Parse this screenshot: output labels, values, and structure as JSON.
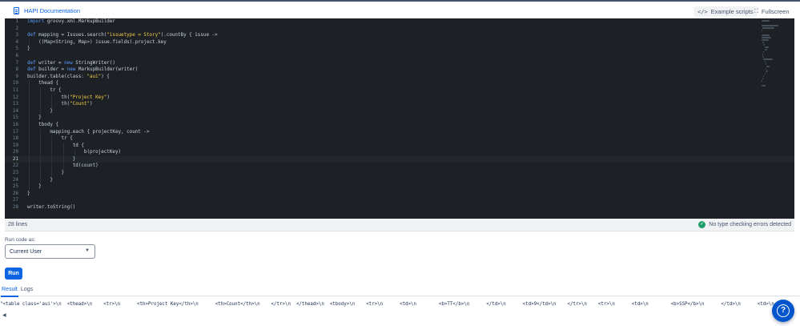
{
  "header": {
    "doc_link": "HAPI Documentation",
    "example_scripts": "Example scripts",
    "fullscreen": "Fullscreen"
  },
  "editor": {
    "lines": [
      "import groovy.xml.MarkupBuilder",
      "",
      "def mapping = Issues.search(\"issuetype = Story\").countBy { issue ->",
      "    ((Map<String, Map>) issue.fields).project.key",
      "}",
      "",
      "def writer = new StringWriter()",
      "def builder = new MarkupBuilder(writer)",
      "builder.table(class: \"aui\") {",
      "    thead {",
      "        tr {",
      "            th(\"Project Key\")",
      "            th(\"Count\")",
      "        }",
      "    }",
      "    tbody {",
      "        mapping.each { projectKey, count ->",
      "            tr {",
      "                td {",
      "                    b(projectKey)",
      "                }",
      "                td(count)",
      "            }",
      "        }",
      "    }",
      "}",
      "",
      "writer.toString()"
    ],
    "active_line": 21
  },
  "status": {
    "lines_count": "28 lines",
    "type_check": "No type checking errors detected"
  },
  "run_as": {
    "label": "Run code as:",
    "value": "Current User"
  },
  "run_button": "Run",
  "tabs": {
    "result": "Result",
    "logs": "Logs"
  },
  "result_text": "\"<table class='aui'>\\n  <thead>\\n    <tr>\\n      <th>Project Key</th>\\n      <th>Count</th>\\n    </tr>\\n  </thead>\\n  <tbody>\\n    <tr>\\n      <td>\\n        <b>TT</b>\\n      </td>\\n      <td>9</td>\\n    </tr>\\n    <tr>\\n      <td>\\n        <b>SSP</b>\\n      </td>\\n      <td>\\n",
  "colors": {
    "editor_bg": "#1d2125",
    "keyword": "#579dff",
    "string": "#f5cd47",
    "brand": "#0c66e4",
    "success": "#22a06b"
  },
  "icons": {
    "doc": "document-icon",
    "code": "code-icon",
    "fullscreen": "fullscreen-icon",
    "check": "check-circle-icon",
    "chevron": "chevron-down-icon",
    "help": "help-icon"
  }
}
